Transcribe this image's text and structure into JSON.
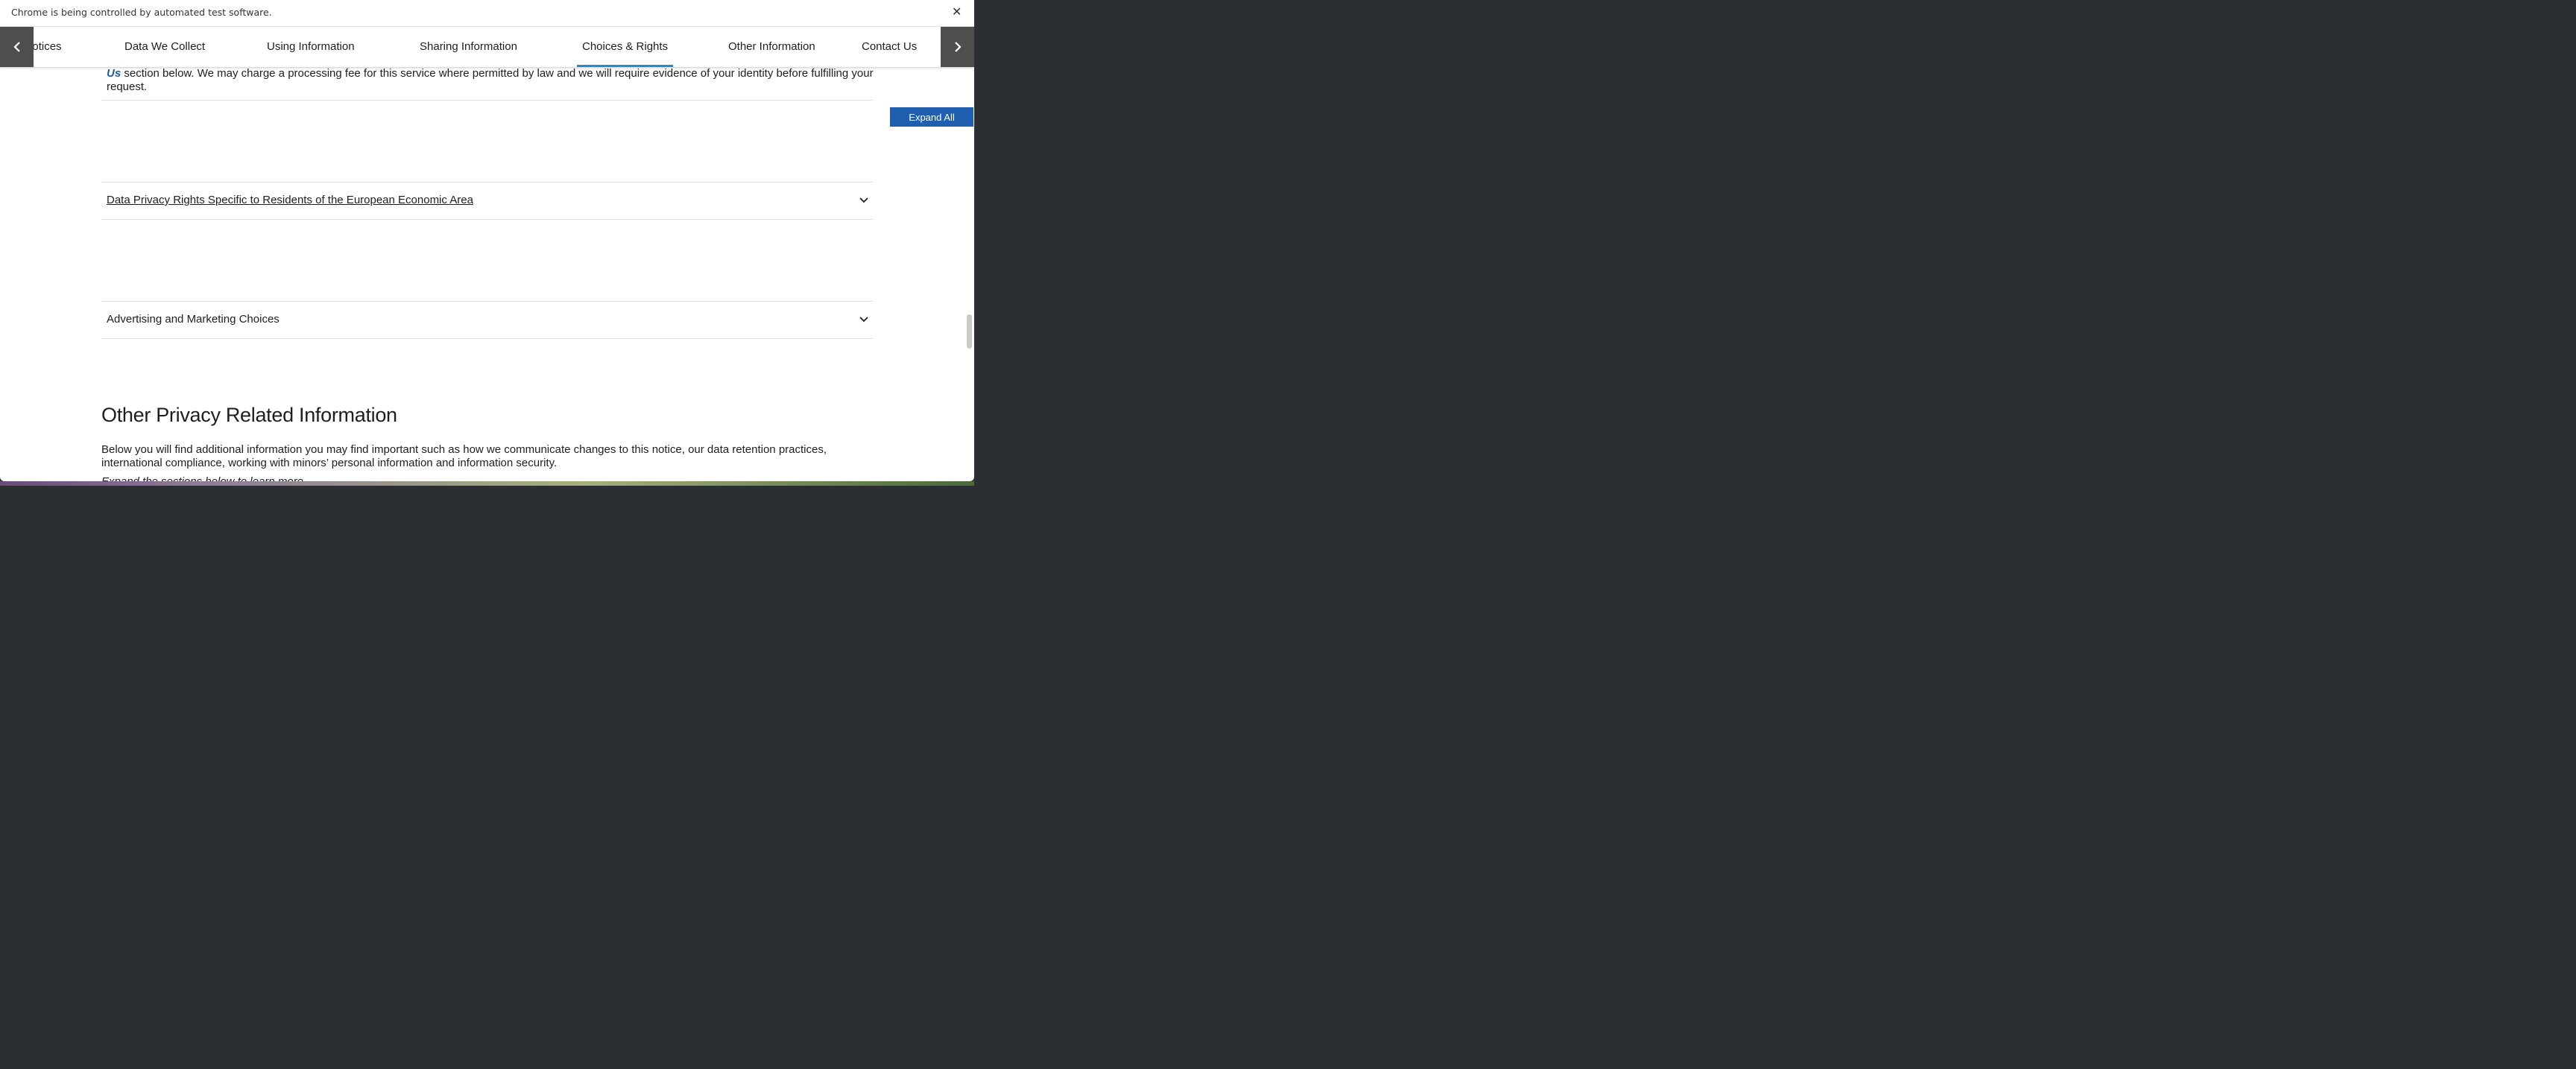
{
  "chrome_banner": {
    "message": "Chrome is being controlled by automated test software.",
    "close_icon": "close-icon"
  },
  "nav": {
    "prev_icon": "chevron-left-icon",
    "next_icon": "chevron-right-icon",
    "items": [
      {
        "label": "onal Notices"
      },
      {
        "label": "Data We Collect"
      },
      {
        "label": "Using Information"
      },
      {
        "label": "Sharing Information"
      },
      {
        "label": "Choices & Rights",
        "active": true
      },
      {
        "label": "Other Information"
      },
      {
        "label": "Contact Us"
      }
    ],
    "accent_color": "#1a8fd1"
  },
  "top_paragraph": {
    "link_text": "Us",
    "text": "section below. We may charge a processing fee for this service where permitted by law and we will require evidence of your identity before fulfilling your request."
  },
  "expand_all_label": "Expand All",
  "accordions": [
    {
      "label": "Data Privacy Rights Specific to Residents of the European Economic Area",
      "icon": "chevron-down-icon"
    },
    {
      "label": "Advertising and Marketing Choices",
      "icon": "chevron-down-icon"
    }
  ],
  "other_section": {
    "title": "Other Privacy Related Information",
    "paragraph": "Below you will find additional information you may find important such as how we communicate changes to this notice, our data retention practices, international compliance, working with minors’ personal information and information security.",
    "cut_line": "Expand the sections below to learn more."
  },
  "colors": {
    "button_bg": "#1f5fad",
    "link": "#1a5fa8"
  }
}
